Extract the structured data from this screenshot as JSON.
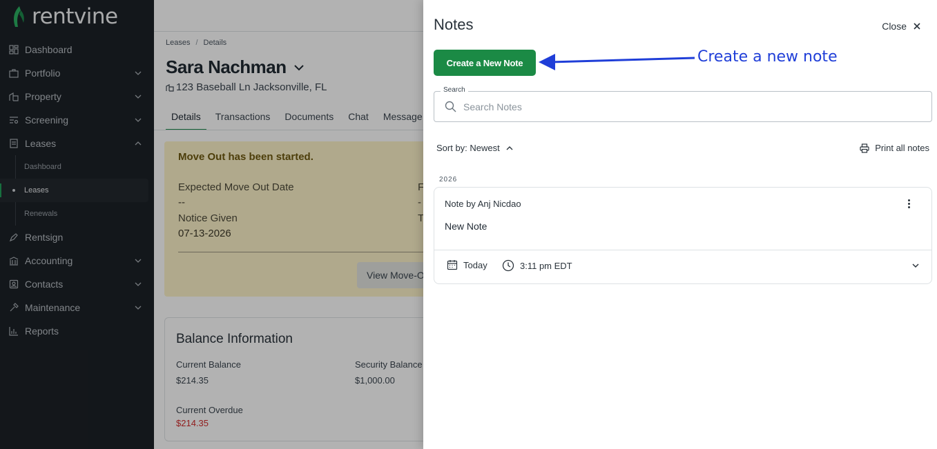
{
  "brand": {
    "name": "rentvine",
    "accent": "#1b8a45"
  },
  "sidebar": {
    "items": [
      {
        "label": "Dashboard",
        "icon": "dashboard-icon",
        "expandable": false
      },
      {
        "label": "Portfolio",
        "icon": "briefcase-icon",
        "expandable": true
      },
      {
        "label": "Property",
        "icon": "building-icon",
        "expandable": true
      },
      {
        "label": "Screening",
        "icon": "screening-icon",
        "expandable": true
      },
      {
        "label": "Leases",
        "icon": "lease-icon",
        "expandable": true,
        "expanded": true
      },
      {
        "label": "Rentsign",
        "icon": "pen-icon",
        "expandable": false
      },
      {
        "label": "Accounting",
        "icon": "bank-icon",
        "expandable": true
      },
      {
        "label": "Contacts",
        "icon": "contact-icon",
        "expandable": true
      },
      {
        "label": "Maintenance",
        "icon": "hammer-icon",
        "expandable": true
      },
      {
        "label": "Reports",
        "icon": "chart-icon",
        "expandable": false
      }
    ],
    "lease_subitems": [
      {
        "label": "Dashboard",
        "active": false
      },
      {
        "label": "Leases",
        "active": true
      },
      {
        "label": "Renewals",
        "active": false
      }
    ]
  },
  "main": {
    "breadcrumb": [
      "Leases",
      "Details"
    ],
    "tenant_name": "Sara Nachman",
    "address": "123 Baseball Ln Jacksonville, FL",
    "tabs": [
      "Details",
      "Transactions",
      "Documents",
      "Chat",
      "Message"
    ],
    "move_out": {
      "title": "Move Out has been started.",
      "expected_label": "Expected Move Out Date",
      "expected_value": "--",
      "notice_label": "Notice Given",
      "notice_value": "07-13-2026",
      "edge_label_1": "F",
      "edge_value_1": "-",
      "edge_label_2": "T",
      "button_label": "View Move-O"
    },
    "balance": {
      "title": "Balance Information",
      "current_balance_label": "Current Balance",
      "current_balance_value": "$214.35",
      "security_balance_label": "Security Balance",
      "security_balance_value": "$1,000.00",
      "current_overdue_label": "Current Overdue",
      "current_overdue_value": "$214.35"
    }
  },
  "notes_panel": {
    "title": "Notes",
    "close_label": "Close",
    "create_button_label": "Create a New Note",
    "annotation": "Create a new note",
    "search_label": "Search",
    "search_placeholder": "Search Notes",
    "sort_label": "Sort by: Newest",
    "print_label": "Print all notes",
    "year_heading": "2026",
    "notes": [
      {
        "author_line": "Note by Anj Nicdao",
        "body": "New Note",
        "date": "Today",
        "time": "3:11 pm EDT"
      }
    ]
  }
}
